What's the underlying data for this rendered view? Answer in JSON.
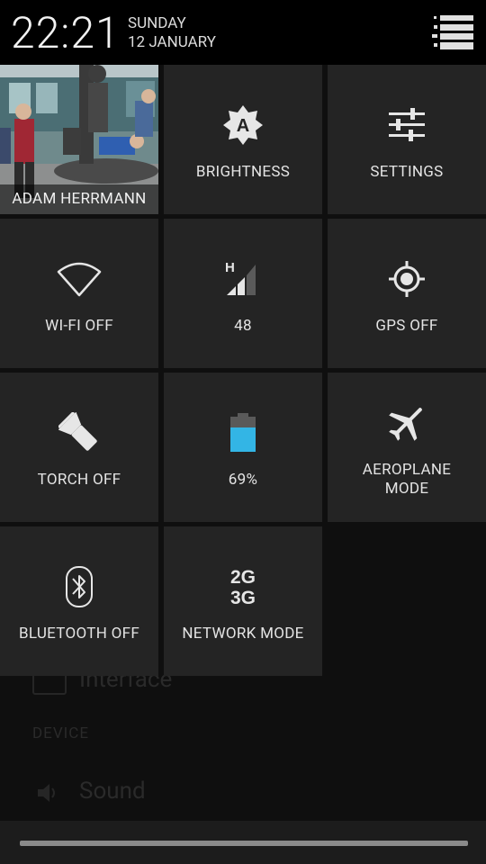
{
  "status": {
    "time": "22:21",
    "day": "SUNDAY",
    "date": "12 JANUARY"
  },
  "background": {
    "interface": "Interface",
    "device": "DEVICE",
    "sound": "Sound"
  },
  "tiles": {
    "user": "ADAM HERRMANN",
    "brightness": "BRIGHTNESS",
    "settings": "SETTINGS",
    "wifi": "WI-FI OFF",
    "signal": "48",
    "signal_type": "H",
    "gps": "GPS OFF",
    "torch": "TORCH OFF",
    "battery": "69%",
    "battery_level": 0.69,
    "aeroplane": "AEROPLANE MODE",
    "bluetooth": "BLUETOOTH OFF",
    "network": "NETWORK MODE",
    "network_glyph_top": "2G",
    "network_glyph_bottom": "3G",
    "brightness_glyph": "A"
  },
  "colors": {
    "accent": "#33b5e5",
    "tile": "#242424"
  }
}
